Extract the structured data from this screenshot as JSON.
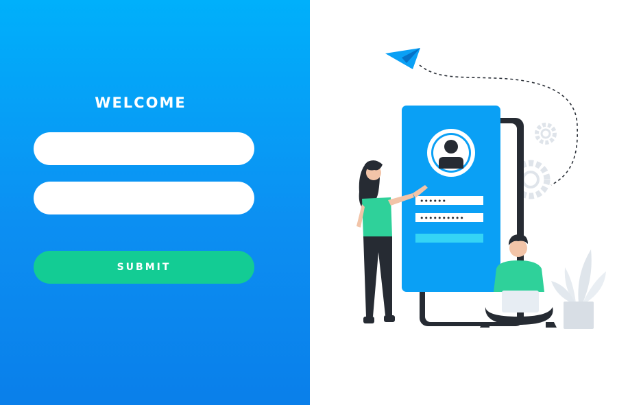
{
  "form": {
    "title": "WELCOME",
    "username_value": "",
    "username_placeholder": "",
    "password_value": "",
    "password_placeholder": "",
    "submit_label": "SUBMIT"
  },
  "illustration": {
    "password_mask_short": "••••••",
    "password_mask_long": "••••••••••"
  },
  "colors": {
    "panel_top": "#00b0fb",
    "panel_bottom": "#0a7fea",
    "submit": "#13cc94",
    "phone_screen": "#0aa0f5",
    "accent_green": "#2fd19a",
    "dark": "#262b33"
  },
  "icons": [
    "paper-plane-icon",
    "gear-icon",
    "user-avatar-icon",
    "plant-icon"
  ]
}
